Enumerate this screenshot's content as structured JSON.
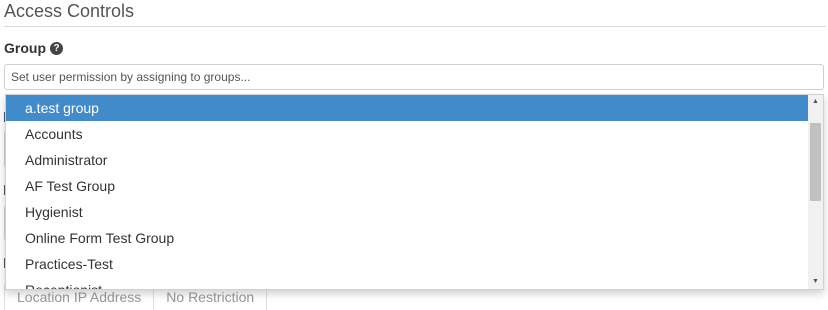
{
  "section": {
    "title": "Access Controls"
  },
  "group": {
    "label": "Group",
    "help_icon": "?",
    "placeholder": "Set user permission by assigning to groups..."
  },
  "dropdown": {
    "options": [
      {
        "label": "a.test group",
        "selected": true
      },
      {
        "label": "Accounts"
      },
      {
        "label": "Administrator"
      },
      {
        "label": "AF Test Group"
      },
      {
        "label": "Hygienist"
      },
      {
        "label": "Online Form Test Group"
      },
      {
        "label": "Practices-Test"
      },
      {
        "label": "Receptionist"
      }
    ],
    "scroll_up": "▲",
    "scroll_down": "▼"
  },
  "ip_table": {
    "col1": "Location IP Address",
    "col2": "No Restriction"
  },
  "colors": {
    "selected_bg": "#428bca",
    "selected_text": "#ffffff"
  }
}
